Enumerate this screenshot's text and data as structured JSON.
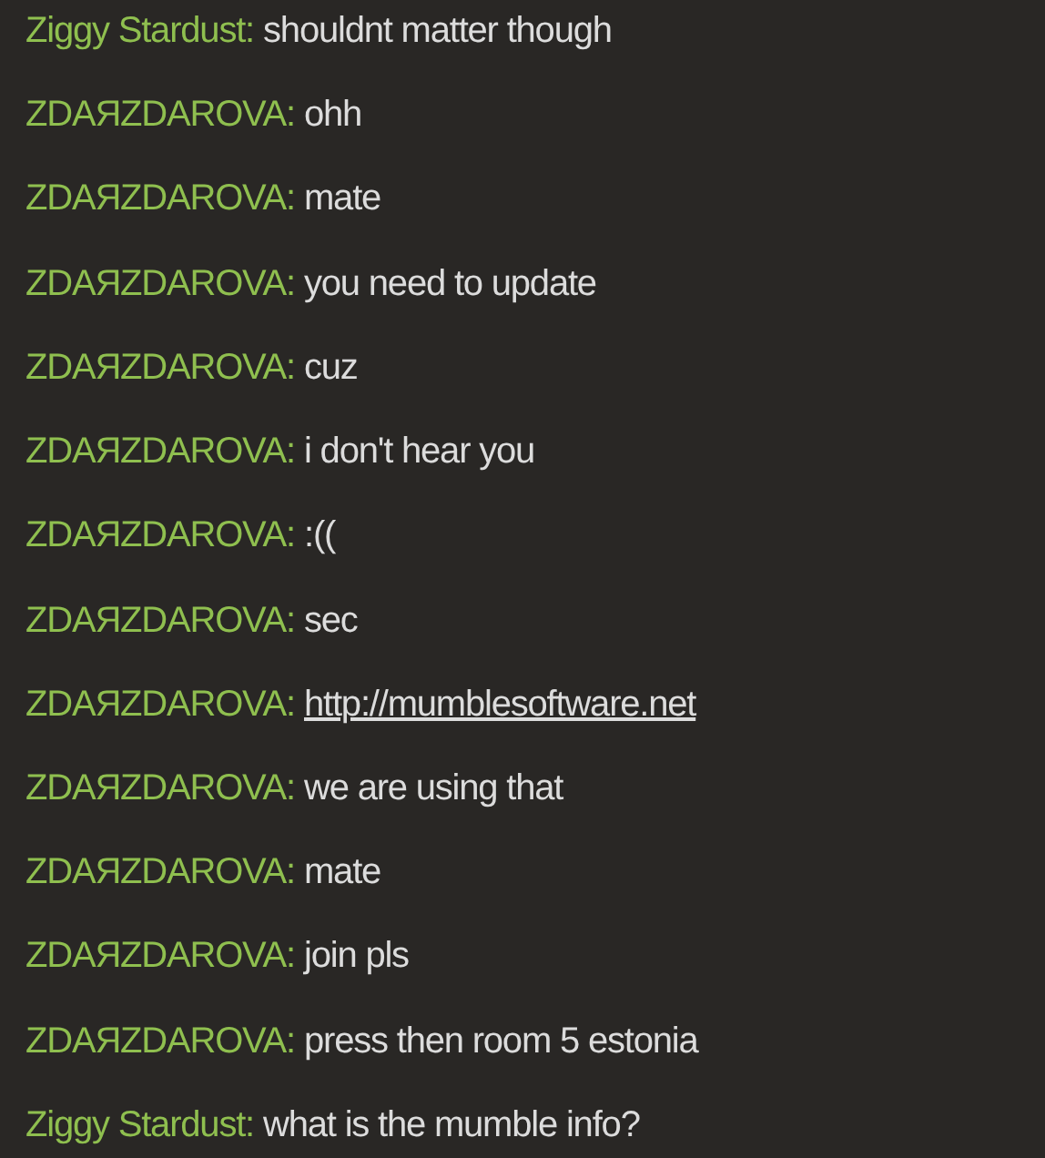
{
  "messages": [
    {
      "author": "Ziggy Stardust:",
      "text": "shouldnt matter though",
      "kind": "text"
    },
    {
      "author": "ZDAЯZDAROVA:",
      "text": "ohh",
      "kind": "text"
    },
    {
      "author": "ZDAЯZDAROVA:",
      "text": "mate",
      "kind": "text"
    },
    {
      "author": "ZDAЯZDAROVA:",
      "text": "you need to update",
      "kind": "text"
    },
    {
      "author": "ZDAЯZDAROVA:",
      "text": "cuz",
      "kind": "text"
    },
    {
      "author": "ZDAЯZDAROVA:",
      "text": "i don't hear you",
      "kind": "text"
    },
    {
      "author": "ZDAЯZDAROVA:",
      "text": ":((",
      "kind": "text"
    },
    {
      "author": "ZDAЯZDAROVA:",
      "text": "sec",
      "kind": "text"
    },
    {
      "author": "ZDAЯZDAROVA:",
      "text": "http://mumblesoftware.net",
      "kind": "link"
    },
    {
      "author": "ZDAЯZDAROVA:",
      "text": "we are using that",
      "kind": "text"
    },
    {
      "author": "ZDAЯZDAROVA:",
      "text": "mate",
      "kind": "text"
    },
    {
      "author": "ZDAЯZDAROVA:",
      "text": "join pls",
      "kind": "text"
    },
    {
      "author": "ZDAЯZDAROVA:",
      "text": "press then room 5 estonia",
      "kind": "text"
    },
    {
      "author": "Ziggy Stardust:",
      "text": "what is the mumble info?",
      "kind": "text"
    }
  ]
}
